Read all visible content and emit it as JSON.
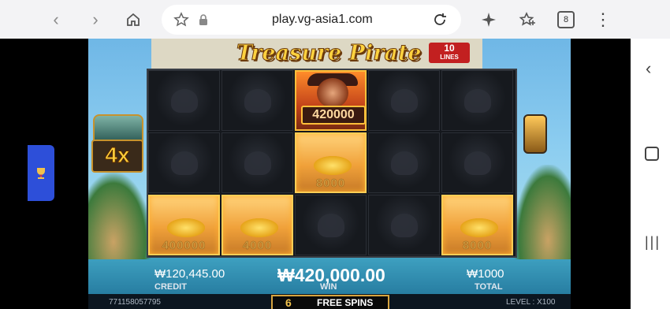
{
  "browser": {
    "url": "play.vg-asia1.com",
    "tab_count": "8"
  },
  "game": {
    "title": "Treasure Pirate",
    "lines_number": "10",
    "lines_label": "LINES",
    "multiplier": "4x",
    "grid": {
      "pirate_value": "420000",
      "cell_values": [
        "8000",
        "400000",
        "4000",
        "8000"
      ]
    },
    "hud": {
      "credit_value": "₩120,445.00",
      "credit_label": "CREDIT",
      "win_value": "₩420,000.00",
      "win_label": "WIN",
      "total_value": "₩1000",
      "total_label": "TOTAL"
    },
    "footer": {
      "id": "771158057795",
      "free_spins_count": "6",
      "free_spins_label": "FREE SPINS",
      "level": "LEVEL : X100"
    }
  },
  "colors": {
    "accent_gold": "#ffce55",
    "trophy_tab": "#2d4fd9"
  }
}
